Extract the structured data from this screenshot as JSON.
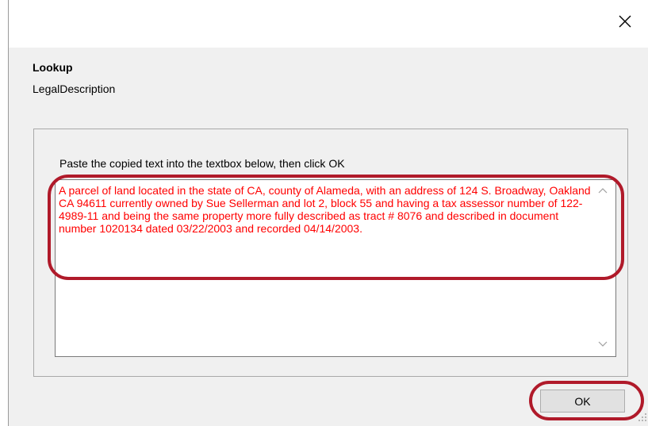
{
  "dialog": {
    "close_glyph": "✕",
    "header_title": "Lookup",
    "header_subtitle": "LegalDescription",
    "instruction": "Paste the copied text into the textbox below, then click OK",
    "textbox_value": "A parcel of land located in the state of CA, county of Alameda, with an address of 124 S. Broadway, Oakland CA 94611 currently owned by Sue Sellerman and lot 2, block 55 and having a tax assessor number of 122-4989-11 and being the same property more fully described as tract # 8076 and described in document number 1020134 dated 03/22/2003 and recorded 04/14/2003.",
    "ok_label": "OK"
  },
  "colors": {
    "text_value": "#ff0000",
    "annotation_highlight": "#b01a2a",
    "dialog_background": "#f0f0f0"
  },
  "icons": {
    "close": "close-icon",
    "scroll_up": "chevron-up-icon",
    "scroll_down": "chevron-down-icon",
    "resize": "resize-grip-icon"
  }
}
